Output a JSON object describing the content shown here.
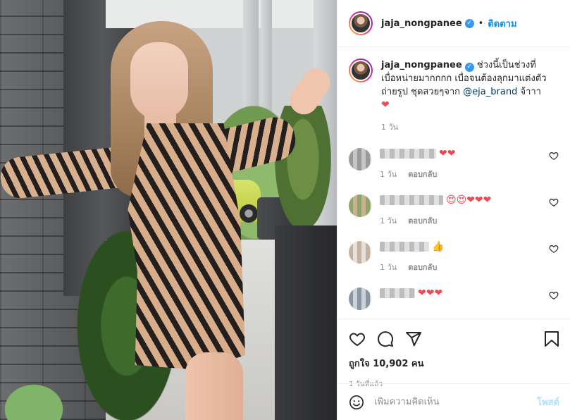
{
  "post": {
    "author": "jaja_nongpanee",
    "verified": true,
    "follow_label": "ติดตาม",
    "separator": "•",
    "caption": {
      "username": "jaja_nongpanee",
      "text_before": "ช่วงนี้เป็นช่วงที่เบื่อหน่ายมากกกก เบื่อจนต้องลุกมาแต่งตัวถ่ายรูป ชุดสวยๆจาก ",
      "mention": "@eja_brand",
      "text_after": " จ้าาา",
      "emoji": "❤",
      "age": "1 วัน"
    },
    "comments": [
      {
        "emoji": "❤❤",
        "age": "1 วัน",
        "reply_label": "ตอบกลับ"
      },
      {
        "emoji": "😍😍❤❤❤",
        "age": "1 วัน",
        "reply_label": "ตอบกลับ"
      },
      {
        "emoji": "👍",
        "age": "1 วัน",
        "reply_label": "ตอบกลับ"
      },
      {
        "emoji": "❤❤❤",
        "age": "",
        "reply_label": ""
      }
    ],
    "likes_text": "ถูกใจ 10,902 คน",
    "timestamp": "1 วันที่แล้ว",
    "add_comment_placeholder": "เพิ่มความคิดเห็น",
    "post_button": "โพสต์"
  },
  "colors": {
    "link_blue": "#0095f6",
    "heart_red": "#ed4956",
    "muted": "#8e8e8e",
    "verified_blue": "#3897f0"
  },
  "icons": [
    "heart-icon",
    "comment-icon",
    "share-icon",
    "bookmark-icon",
    "emoji-icon",
    "verified-badge-icon"
  ]
}
